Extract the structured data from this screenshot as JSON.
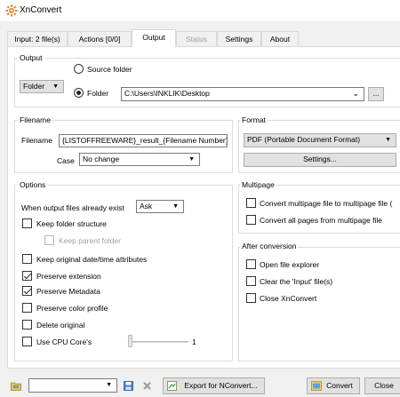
{
  "window": {
    "title": "XnConvert",
    "icon": "xnconvert-logo-icon"
  },
  "tabs": [
    {
      "label": "Input: 2 file(s)",
      "state": "normal"
    },
    {
      "label": "Actions [0/0]",
      "state": "normal"
    },
    {
      "label": "Output",
      "state": "active"
    },
    {
      "label": "Status",
      "state": "disabled"
    },
    {
      "label": "Settings",
      "state": "normal"
    },
    {
      "label": "About",
      "state": "normal"
    }
  ],
  "output": {
    "legend": "Output",
    "type_combo": "Folder",
    "source_folder_label": "Source folder",
    "folder_label": "Folder",
    "selected_radio": "Folder",
    "folder_path": "C:\\Users\\INKLIK\\Desktop",
    "browse_label": "..."
  },
  "filename": {
    "legend": "Filename",
    "filename_label": "Filename",
    "filename_value": "{LISTOFFREEWARE}_result_{Filename Number}",
    "case_label": "Case",
    "case_value": "No change"
  },
  "format": {
    "legend": "Format",
    "format_value": "PDF (Portable Document Format)",
    "settings_label": "Settings..."
  },
  "options": {
    "legend": "Options",
    "exists_label": "When output files already exist",
    "exists_value": "Ask",
    "items": [
      {
        "label": "Keep folder structure",
        "checked": false,
        "enabled": true
      },
      {
        "label": "Keep parent folder",
        "checked": false,
        "enabled": false
      },
      {
        "label": "Keep original date/time attributes",
        "checked": false,
        "enabled": true
      },
      {
        "label": "Preserve extension",
        "checked": true,
        "enabled": true
      },
      {
        "label": "Preserve Metadata",
        "checked": true,
        "enabled": true
      },
      {
        "label": "Preserve color profile",
        "checked": false,
        "enabled": true
      },
      {
        "label": "Delete original",
        "checked": false,
        "enabled": true
      },
      {
        "label": "Use CPU Core's",
        "checked": false,
        "enabled": true
      }
    ],
    "cpu_cores_value": "1"
  },
  "multipage": {
    "legend": "Multipage",
    "items": [
      {
        "label": "Convert multipage file to multipage file (",
        "checked": false
      },
      {
        "label": "Convert all pages from multipage file",
        "checked": false
      }
    ]
  },
  "after": {
    "legend": "After conversion",
    "items": [
      {
        "label": "Open file explorer",
        "checked": false
      },
      {
        "label": "Clear the 'Input' file(s)",
        "checked": false
      },
      {
        "label": "Close XnConvert",
        "checked": false
      }
    ]
  },
  "bottom": {
    "preset_value": "",
    "export_label": "Export for NConvert...",
    "convert_label": "Convert",
    "close_label": "Close"
  },
  "colors": {
    "window_bg": "#f0f0f0",
    "panel_bg": "#ffffff",
    "border": "#dcdcdc",
    "disabled_text": "#a0a0a0"
  }
}
